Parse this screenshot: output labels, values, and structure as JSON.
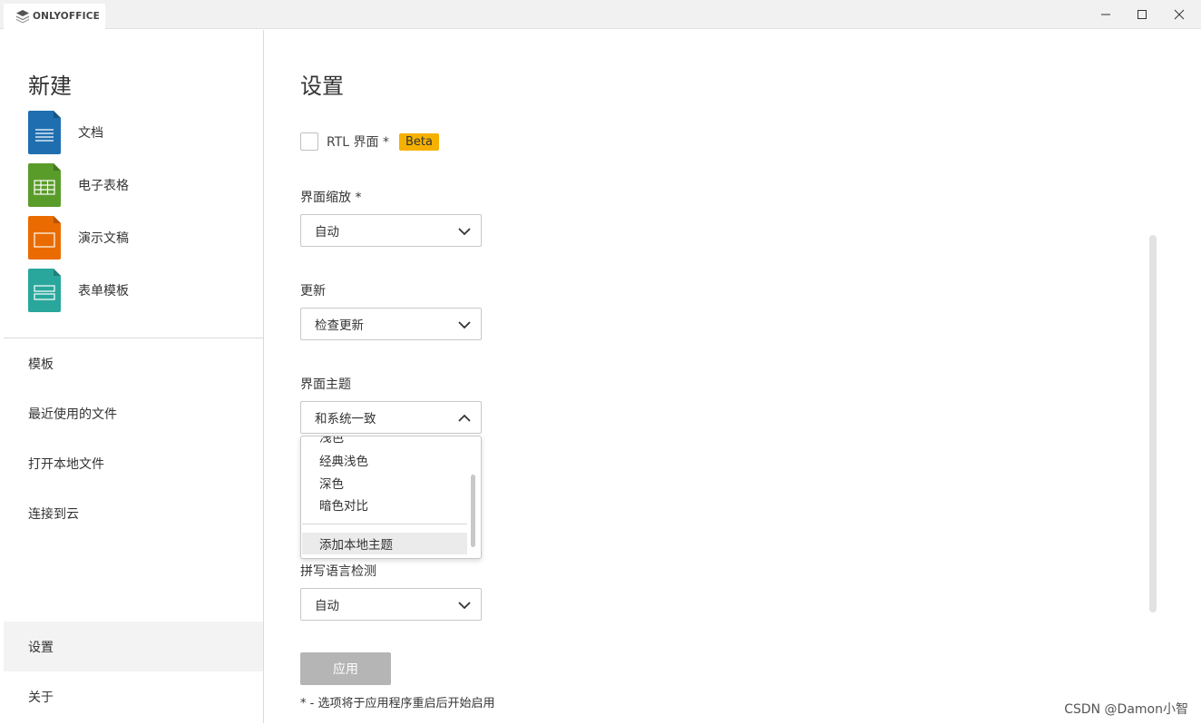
{
  "window": {
    "app_name": "ONLYOFFICE"
  },
  "sidebar": {
    "new_title": "新建",
    "new_items": [
      {
        "label": "文档",
        "icon": "document-icon",
        "color": "#1f6fb0"
      },
      {
        "label": "电子表格",
        "icon": "spreadsheet-icon",
        "color": "#5a9c2a"
      },
      {
        "label": "演示文稿",
        "icon": "presentation-icon",
        "color": "#ea6c00"
      },
      {
        "label": "表单模板",
        "icon": "form-template-icon",
        "color": "#2aa79c"
      }
    ],
    "nav_items": [
      {
        "label": "模板"
      },
      {
        "label": "最近使用的文件"
      },
      {
        "label": "打开本地文件"
      },
      {
        "label": "连接到云"
      }
    ],
    "bottom_items": [
      {
        "label": "设置",
        "active": true
      },
      {
        "label": "关于",
        "active": false
      }
    ]
  },
  "settings": {
    "title": "设置",
    "rtl_label": "RTL 界面 *",
    "rtl_checked": false,
    "beta_badge": "Beta",
    "scale_label": "界面缩放 *",
    "scale_value": "自动",
    "update_label": "更新",
    "update_value": "检查更新",
    "theme_label": "界面主题",
    "theme_value": "和系统一致",
    "theme_options": {
      "partial": "浅色",
      "items": [
        "经典浅色",
        "深色",
        "暗色对比"
      ],
      "add_local": "添加本地主题"
    },
    "spell_label": "拼写语言检测",
    "spell_value": "自动",
    "apply_label": "应用",
    "note": "* - 选项将于应用程序重启后开始启用"
  },
  "watermark": "CSDN @Damon小智",
  "colors": {
    "beta": "#f6b100",
    "apply_disabled": "#b5b5b5",
    "active_nav": "#f3f3f3"
  }
}
